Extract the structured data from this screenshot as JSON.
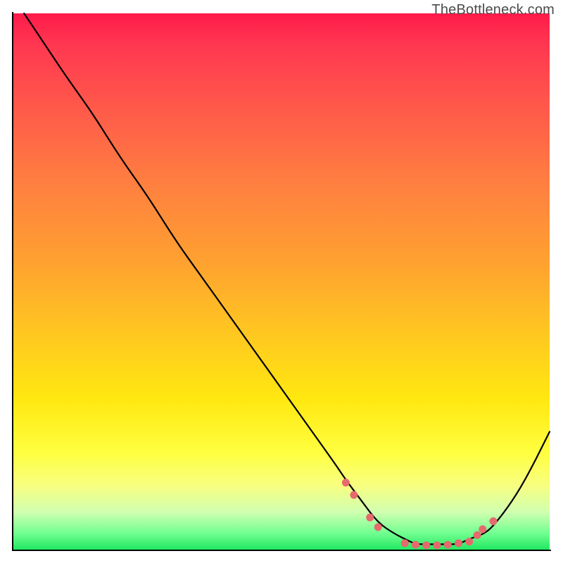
{
  "watermark": "TheBottleneck.com",
  "colors": {
    "curve_stroke": "#000000",
    "marker_fill": "#e56a6e",
    "axis": "#000000"
  },
  "chart_data": {
    "type": "line",
    "title": "",
    "xlabel": "",
    "ylabel": "",
    "xlim": [
      0,
      100
    ],
    "ylim": [
      0,
      100
    ],
    "series": [
      {
        "name": "bottleneck-curve",
        "x": [
          2,
          6,
          10,
          15,
          20,
          25,
          30,
          35,
          40,
          45,
          50,
          55,
          60,
          62,
          65,
          68,
          71,
          73,
          75,
          78,
          80,
          83,
          85,
          88,
          90,
          93,
          96,
          100
        ],
        "y": [
          100,
          94,
          88,
          81,
          73,
          66,
          58,
          51,
          44,
          37,
          30,
          23,
          16,
          13,
          9,
          5,
          3,
          2,
          1,
          1,
          1,
          1,
          2,
          3,
          5,
          9,
          14,
          22
        ]
      }
    ],
    "markers": [
      {
        "x": 62,
        "y": 12.5
      },
      {
        "x": 63.5,
        "y": 10.2
      },
      {
        "x": 66.5,
        "y": 6.0
      },
      {
        "x": 68,
        "y": 4.2
      },
      {
        "x": 73,
        "y": 1.2
      },
      {
        "x": 75,
        "y": 0.9
      },
      {
        "x": 77,
        "y": 0.8
      },
      {
        "x": 79,
        "y": 0.8
      },
      {
        "x": 81,
        "y": 0.9
      },
      {
        "x": 83,
        "y": 1.2
      },
      {
        "x": 85,
        "y": 1.5
      },
      {
        "x": 86.5,
        "y": 2.7
      },
      {
        "x": 87.5,
        "y": 3.8
      },
      {
        "x": 89.5,
        "y": 5.3
      }
    ],
    "marker_radius": 5.5
  }
}
